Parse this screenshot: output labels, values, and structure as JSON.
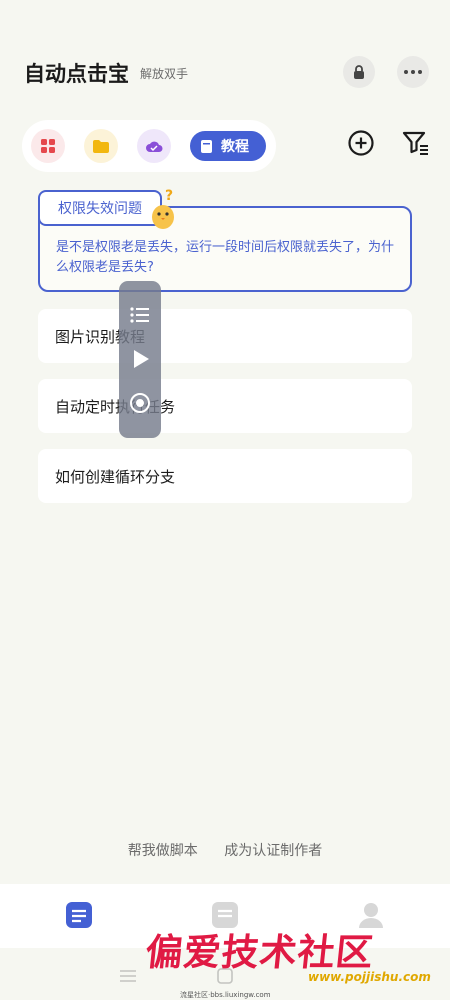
{
  "header": {
    "title": "自动点击宝",
    "subtitle": "解放双手"
  },
  "tabs": {
    "active_label": "教程"
  },
  "featured": {
    "tag": "权限失效问题",
    "description": "是不是权限老是丢失，运行一段时间后权限就丢失了，为什么权限老是丢失?"
  },
  "list": [
    {
      "label": "图片识别教程"
    },
    {
      "label": "自动定时执行任务"
    },
    {
      "label": "如何创建循环分支"
    }
  ],
  "bottom_links": {
    "make_script": "帮我做脚本",
    "become_author": "成为认证制作者"
  },
  "watermark": {
    "text": "偏爱技术社区",
    "url": "www.pojjishu.com",
    "small": "流星社区·bbs.liuxingw.com"
  },
  "colors": {
    "accent": "#4460d4",
    "background": "#f6f7f1"
  },
  "icons": {
    "lock": "lock-icon",
    "more": "more-icon",
    "add": "plus-circle-icon",
    "filter": "filter-icon"
  }
}
